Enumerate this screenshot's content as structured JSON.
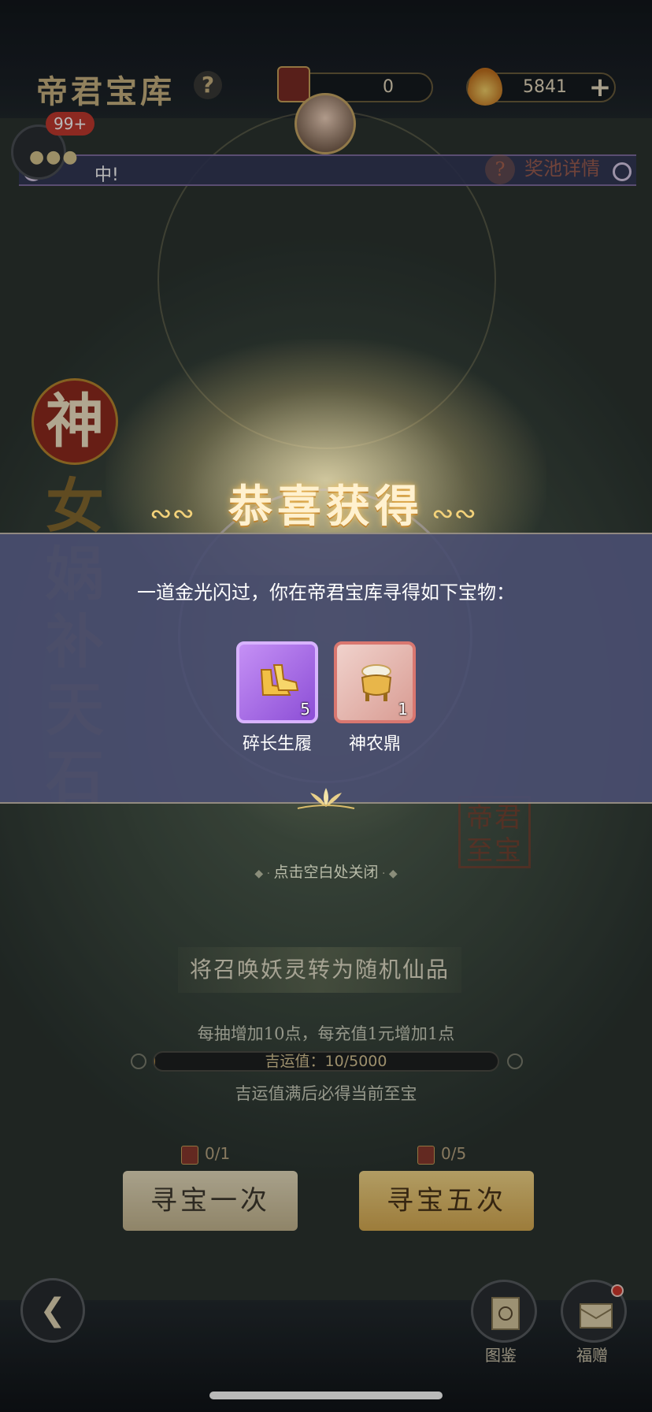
{
  "header": {
    "title": "帝君宝库",
    "help_icon": "?",
    "ticket_count": "0",
    "jade_count": "5841",
    "plus_label": "+"
  },
  "chat": {
    "badge": "99+",
    "marquee_text": "中!"
  },
  "pool_details": {
    "label": "奖池详情",
    "icon": "?"
  },
  "background": {
    "seal_char": "神",
    "vertical_chars": [
      "女",
      "娲",
      "补",
      "天",
      "石"
    ],
    "stamp_text": "帝君至宝"
  },
  "popup": {
    "title": "恭喜获得",
    "message": "一道金光闪过，你在帝君宝库寻得如下宝物：",
    "rewards": [
      {
        "name": "碎长生履",
        "count": "5",
        "rarity": "purple",
        "icon": "golden-boots-icon"
      },
      {
        "name": "神农鼎",
        "count": "1",
        "rarity": "red",
        "icon": "cauldron-icon"
      }
    ],
    "close_hint": "点击空白处关闭"
  },
  "summon": {
    "convert_label": "将召唤妖灵转为随机仙品",
    "rule_line1": "每抽增加10点，每充值1元增加1点",
    "luck_label": "吉运值：10/5000",
    "luck_value": 10,
    "luck_max": 5000,
    "rule_line2": "吉运值满后必得当前至宝",
    "cost_once": "0/1",
    "cost_five": "0/5",
    "draw_once_label": "寻宝一次",
    "draw_five_label": "寻宝五次"
  },
  "footer": {
    "back_icon": "back-arrow-icon",
    "codex_label": "图鉴",
    "gift_label": "福赠"
  },
  "colors": {
    "banner": "#4a4e70",
    "gold": "#f3d27a",
    "purple_rarity": "#c590f5",
    "red_rarity": "#d97770"
  }
}
